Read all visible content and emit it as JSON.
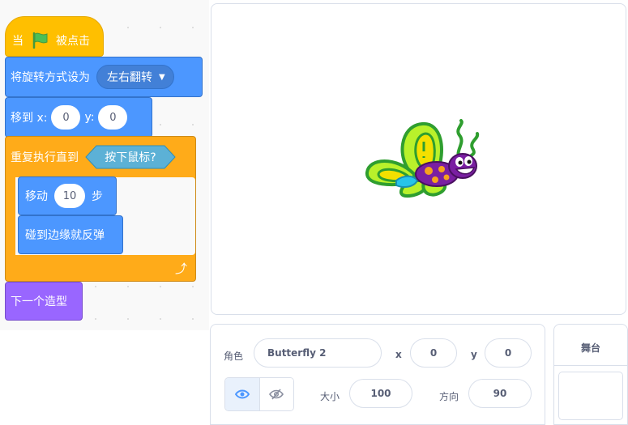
{
  "blocks": {
    "when_flag": {
      "prefix": "当",
      "suffix": "被点击",
      "icon": "green-flag-icon"
    },
    "rotation": {
      "label": "将旋转方式设为",
      "value": "左右翻转"
    },
    "goto": {
      "label": "移到 x:",
      "x": "0",
      "y_label": "y:",
      "y": "0"
    },
    "repeat_until": {
      "label": "重复执行直到",
      "condition": "按下鼠标?"
    },
    "move": {
      "label": "移动",
      "steps": "10",
      "unit": "步"
    },
    "bounce": {
      "label": "碰到边缘就反弹"
    },
    "next_costume": {
      "label": "下一个造型"
    }
  },
  "sprite_info": {
    "sprite_label": "角色",
    "sprite_name": "Butterfly 2",
    "x_label": "x",
    "x_value": "0",
    "y_label": "y",
    "y_value": "0",
    "size_label": "大小",
    "size_value": "100",
    "direction_label": "方向",
    "direction_value": "90",
    "show_icon": "eye-icon",
    "hide_icon": "eye-slash-icon"
  },
  "stage_panel": {
    "title": "舞台"
  },
  "colors": {
    "events": "#ffbf00",
    "motion": "#4c97ff",
    "control": "#ffab19",
    "looks": "#9966ff",
    "sensing": "#5cb1d6"
  }
}
